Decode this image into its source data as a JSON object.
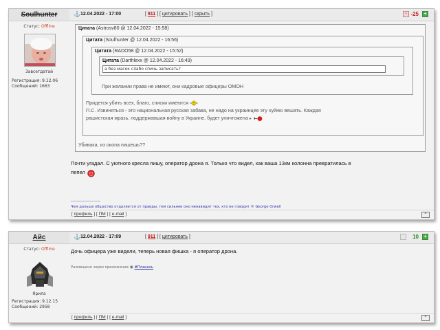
{
  "post1": {
    "author": {
      "nick": "Soulhunter",
      "status_label": "Статус:",
      "status_value": "Offline",
      "caption": "Завсегдатай",
      "reg_label": "Регистрация: 9.12.06",
      "messages_label": "Сообщений: 1663"
    },
    "header": {
      "time": "12.04.2022 - 17:00",
      "number": "911",
      "quote_link": "цитировать",
      "hide_link": "скрыть",
      "rating": "-25",
      "rating_color": "#cc2222"
    },
    "quote1": {
      "label": "Цитата",
      "source": "(Astrosv80 @ 12.04.2022 - 15:58)"
    },
    "quote2": {
      "label": "Цитата",
      "source": "(Soulhunter @ 12.04.2022 - 16:56)"
    },
    "quote3": {
      "label": "Цитата",
      "source": "(RADO58 @ 12.04.2022 - 15:52)"
    },
    "quote4": {
      "label": "Цитата",
      "source": "(Darthlexx @ 12.04.2022 - 16:49)",
      "text": "а без масок слабо спичь записать?"
    },
    "quote3_text": "При желании права не имеют, они кадровые офицеры ОМОН",
    "quote2_text1": "Придется убить всех, благо, списки имеются",
    "quote2_text2": "П.С. Извиняться - это национальная русская забава, не надо на украинцев эту хуйню вешать. Каждая",
    "quote2_text3": "рашистская мразь, поддержавшая войну в Украине, будет уничтожена",
    "quote1_text": "Убивака, из окопа пишешь??",
    "body_line1": "Почти угадал. С уютного кресла пишу, оператор дрона я. Только что видел, как ваша 13км колонна превратилась в",
    "body_line2": "пепел",
    "sig_sep": "--------------------",
    "signature": "Чем дальше общество отдаляется от правды, тем сильнее оно ненавидит тех, кто ее говорит © George Orwell",
    "footer": {
      "profile": "профиль",
      "pm": "ПМ",
      "email": "e-mail"
    }
  },
  "post2": {
    "author": {
      "nick": "Айс",
      "status_label": "Статус:",
      "status_value": "Offline",
      "caption": "Ярила",
      "reg_label": "Регистрация: 9.12.15",
      "messages_label": "Сообщений: 2958"
    },
    "header": {
      "time": "12.04.2022 - 17:09",
      "number": "911",
      "quote_link": "цитировать",
      "rating": "10",
      "rating_color": "#228822"
    },
    "body": "Дочь офицера уже видели, теперь новая фишка - я оператор дрона.",
    "app_note": "Размещено через приложение",
    "app_tag": "#Плакаль",
    "footer": {
      "profile": "профиль",
      "pm": "ПМ",
      "email": "e-mail"
    }
  },
  "icons": [
    "anchor-icon",
    "rate-minus-icon",
    "rate-plus-icon",
    "scroll-top-icon",
    "smiley-icon"
  ]
}
